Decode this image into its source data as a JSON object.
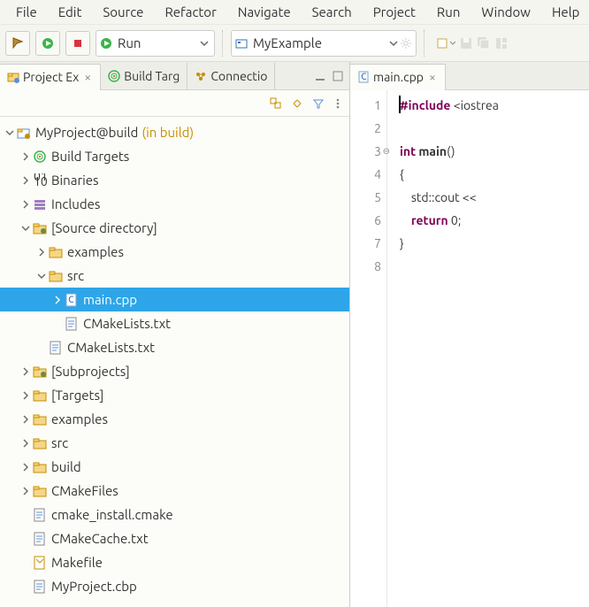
{
  "menu": [
    "File",
    "Edit",
    "Source",
    "Refactor",
    "Navigate",
    "Search",
    "Project",
    "Run",
    "Window",
    "Help"
  ],
  "toolbar": {
    "run_sel": "Run",
    "project_sel": "MyExample"
  },
  "left_views": [
    {
      "name": "project-explorer",
      "label": "Project Ex",
      "active": true,
      "closable": true,
      "icon": "project-explorer"
    },
    {
      "name": "build-targets",
      "label": "Build Targ",
      "active": false,
      "closable": false,
      "icon": "target"
    },
    {
      "name": "connections",
      "label": "Connectio",
      "active": false,
      "closable": false,
      "icon": "connections"
    }
  ],
  "tree": [
    {
      "d": 0,
      "tw": "v",
      "icon": "proj",
      "label": "MyProject@build",
      "suffix": "(in build)"
    },
    {
      "d": 1,
      "tw": ">",
      "icon": "target",
      "label": "Build Targets"
    },
    {
      "d": 1,
      "tw": ">",
      "icon": "bin",
      "label": "Binaries"
    },
    {
      "d": 1,
      "tw": ">",
      "icon": "inc",
      "label": "Includes"
    },
    {
      "d": 1,
      "tw": "v",
      "icon": "srcdir",
      "label": "[Source directory]"
    },
    {
      "d": 2,
      "tw": ">",
      "icon": "folder",
      "label": "examples"
    },
    {
      "d": 2,
      "tw": "v",
      "icon": "folder",
      "label": "src"
    },
    {
      "d": 3,
      "tw": ">",
      "icon": "cfile",
      "label": "main.cpp",
      "sel": true
    },
    {
      "d": 3,
      "tw": "",
      "icon": "file",
      "label": "CMakeLists.txt"
    },
    {
      "d": 2,
      "tw": "",
      "icon": "file",
      "label": "CMakeLists.txt"
    },
    {
      "d": 1,
      "tw": ">",
      "icon": "srcdir",
      "label": "[Subprojects]"
    },
    {
      "d": 1,
      "tw": ">",
      "icon": "folder",
      "label": "[Targets]"
    },
    {
      "d": 1,
      "tw": ">",
      "icon": "folder",
      "label": "examples"
    },
    {
      "d": 1,
      "tw": ">",
      "icon": "folder",
      "label": "src"
    },
    {
      "d": 1,
      "tw": ">",
      "icon": "folder",
      "label": "build"
    },
    {
      "d": 1,
      "tw": ">",
      "icon": "folder",
      "label": "CMakeFiles"
    },
    {
      "d": 1,
      "tw": "",
      "icon": "file",
      "label": "cmake_install.cmake"
    },
    {
      "d": 1,
      "tw": "",
      "icon": "file",
      "label": "CMakeCache.txt"
    },
    {
      "d": 1,
      "tw": "",
      "icon": "mkfile",
      "label": "Makefile"
    },
    {
      "d": 1,
      "tw": "",
      "icon": "file",
      "label": "MyProject.cbp"
    }
  ],
  "editor": {
    "tab": "main.cpp",
    "lines": [
      {
        "n": 1,
        "html": "<span class='pp'>#include</span> &lt;iostrea"
      },
      {
        "n": 2,
        "html": ""
      },
      {
        "n": 3,
        "html": "<span class='kw'>int</span> <b>main</b>()",
        "fold": true
      },
      {
        "n": 4,
        "html": "{"
      },
      {
        "n": 5,
        "html": "    std::cout &lt;&lt;"
      },
      {
        "n": 6,
        "html": "    <span class='kw'>return</span> 0;"
      },
      {
        "n": 7,
        "html": "}"
      },
      {
        "n": 8,
        "html": ""
      }
    ]
  }
}
